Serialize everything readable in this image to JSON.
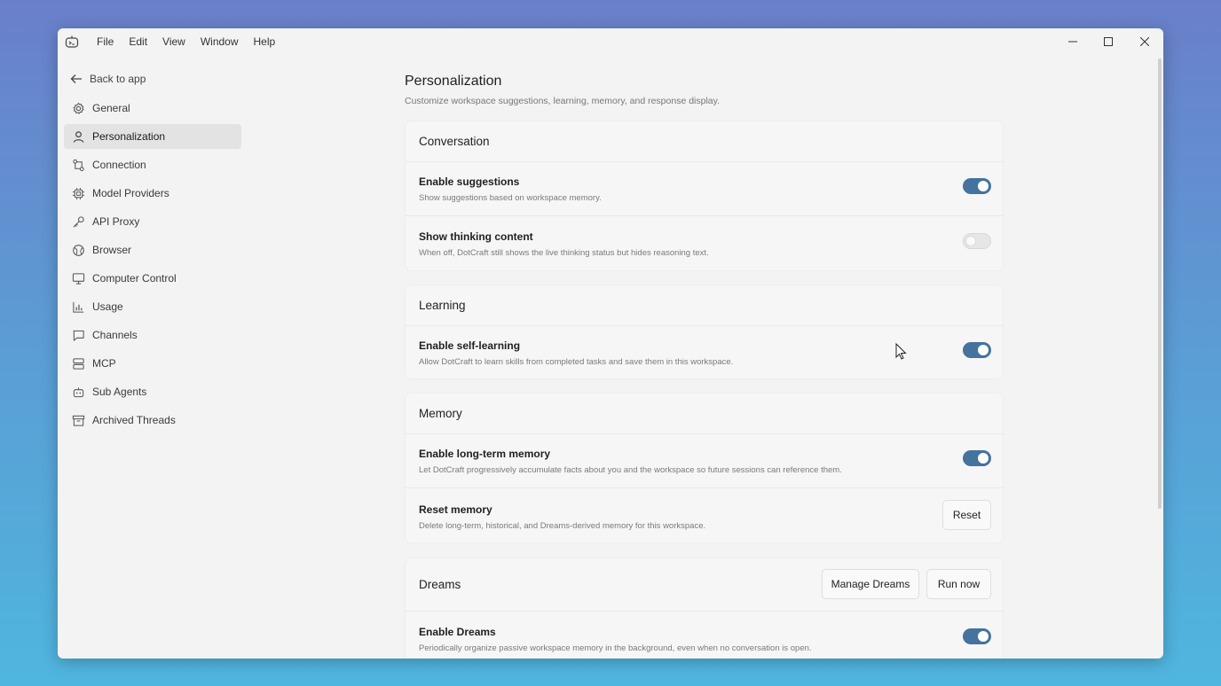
{
  "menu": [
    "File",
    "Edit",
    "View",
    "Window",
    "Help"
  ],
  "sidebar": {
    "back_label": "Back to app",
    "items": [
      {
        "label": "General",
        "icon": "gear-icon"
      },
      {
        "label": "Personalization",
        "icon": "person-icon",
        "active": true
      },
      {
        "label": "Connection",
        "icon": "connection-icon"
      },
      {
        "label": "Model Providers",
        "icon": "chip-icon"
      },
      {
        "label": "API Proxy",
        "icon": "key-icon"
      },
      {
        "label": "Browser",
        "icon": "globe-icon"
      },
      {
        "label": "Computer Control",
        "icon": "monitor-icon"
      },
      {
        "label": "Usage",
        "icon": "bar-chart-icon"
      },
      {
        "label": "Channels",
        "icon": "chat-icon"
      },
      {
        "label": "MCP",
        "icon": "server-icon"
      },
      {
        "label": "Sub Agents",
        "icon": "robot-icon"
      },
      {
        "label": "Archived Threads",
        "icon": "archive-icon"
      }
    ]
  },
  "page": {
    "title": "Personalization",
    "subtitle": "Customize workspace suggestions, learning, memory, and response display."
  },
  "conversation": {
    "title": "Conversation",
    "suggestions_label": "Enable suggestions",
    "suggestions_desc": "Show suggestions based on workspace memory.",
    "suggestions_on": true,
    "thinking_label": "Show thinking content",
    "thinking_desc": "When off, DotCraft still shows the live thinking status but hides reasoning text.",
    "thinking_on": false
  },
  "learning": {
    "title": "Learning",
    "self_label": "Enable self-learning",
    "self_desc": "Allow DotCraft to learn skills from completed tasks and save them in this workspace.",
    "self_on": true
  },
  "memory": {
    "title": "Memory",
    "longterm_label": "Enable long-term memory",
    "longterm_desc": "Let DotCraft progressively accumulate facts about you and the workspace so future sessions can reference them.",
    "longterm_on": true,
    "reset_label": "Reset memory",
    "reset_desc": "Delete long-term, historical, and Dreams-derived memory for this workspace.",
    "reset_button": "Reset"
  },
  "dreams": {
    "title": "Dreams",
    "manage_button": "Manage Dreams",
    "run_button": "Run now",
    "enable_label": "Enable Dreams",
    "enable_desc": "Periodically organize passive workspace memory in the background, even when no conversation is open.",
    "enable_on": true
  },
  "colors": {
    "toggle_on": "#45739d",
    "window_bg": "#f3f3f3"
  }
}
